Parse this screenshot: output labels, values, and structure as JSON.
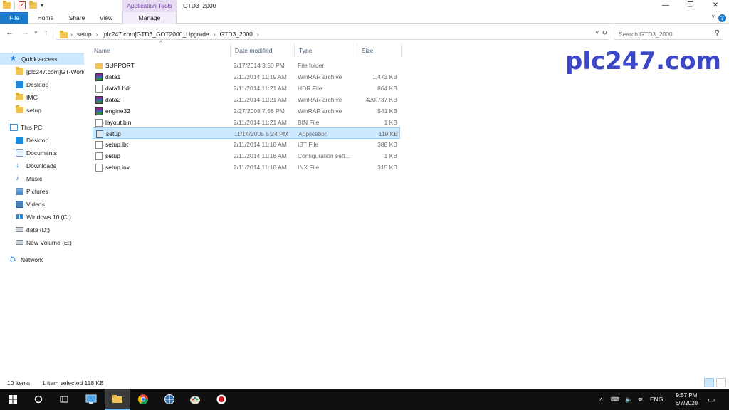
{
  "titlebar": {
    "contextual_group": "Application Tools",
    "window_title": "GTD3_2000",
    "minimize": "—",
    "maximize": "❐",
    "close": "✕"
  },
  "ribbon": {
    "tabs": [
      "File",
      "Home",
      "Share",
      "View",
      "Manage"
    ]
  },
  "address": {
    "crumbs": [
      "setup",
      "[plc247.com]GTD3_GOT2000_Upgrade",
      "GTD3_2000"
    ],
    "search_placeholder": "Search GTD3_2000"
  },
  "nav": {
    "items": [
      {
        "label": "Quick access",
        "icon": "star-icon"
      },
      {
        "label": "[plc247.com]GT-Works",
        "icon": "folder-icon"
      },
      {
        "label": "Desktop",
        "icon": "desktop-icon"
      },
      {
        "label": "IMG",
        "icon": "folder-icon"
      },
      {
        "label": "setup",
        "icon": "folder-icon"
      },
      {
        "label": "This PC",
        "icon": "pc-icon"
      },
      {
        "label": "Desktop",
        "icon": "desktop-icon"
      },
      {
        "label": "Documents",
        "icon": "documents-icon"
      },
      {
        "label": "Downloads",
        "icon": "download-icon"
      },
      {
        "label": "Music",
        "icon": "music-icon"
      },
      {
        "label": "Pictures",
        "icon": "pictures-icon"
      },
      {
        "label": "Videos",
        "icon": "videos-icon"
      },
      {
        "label": "Windows 10 (C:)",
        "icon": "windows-drive-icon"
      },
      {
        "label": "data (D:)",
        "icon": "drive-icon"
      },
      {
        "label": "New Volume (E:)",
        "icon": "drive-icon"
      },
      {
        "label": "Network",
        "icon": "network-icon"
      }
    ]
  },
  "columns": {
    "name": "Name",
    "date": "Date modified",
    "type": "Type",
    "size": "Size"
  },
  "files": [
    {
      "name": "SUPPORT",
      "date": "2/17/2014 3:50 PM",
      "type": "File folder",
      "size": "",
      "icon": "folder-icon"
    },
    {
      "name": "data1",
      "date": "2/11/2014 11:19 AM",
      "type": "WinRAR archive",
      "size": "1,473 KB",
      "icon": "winrar-icon"
    },
    {
      "name": "data1.hdr",
      "date": "2/11/2014 11:21 AM",
      "type": "HDR File",
      "size": "864 KB",
      "icon": "file-icon"
    },
    {
      "name": "data2",
      "date": "2/11/2014 11:21 AM",
      "type": "WinRAR archive",
      "size": "420,737 KB",
      "icon": "winrar-icon"
    },
    {
      "name": "engine32",
      "date": "2/27/2008 7:56 PM",
      "type": "WinRAR archive",
      "size": "541 KB",
      "icon": "winrar-icon"
    },
    {
      "name": "layout.bin",
      "date": "2/11/2014 11:21 AM",
      "type": "BIN File",
      "size": "1 KB",
      "icon": "file-icon"
    },
    {
      "name": "setup",
      "date": "11/14/2005 5:24 PM",
      "type": "Application",
      "size": "119 KB",
      "icon": "application-icon"
    },
    {
      "name": "setup.ibt",
      "date": "2/11/2014 11:18 AM",
      "type": "IBT File",
      "size": "388 KB",
      "icon": "file-icon"
    },
    {
      "name": "setup",
      "date": "2/11/2014 11:18 AM",
      "type": "Configuration sett...",
      "size": "1 KB",
      "icon": "config-icon"
    },
    {
      "name": "setup.inx",
      "date": "2/11/2014 11:18 AM",
      "type": "INX File",
      "size": "315 KB",
      "icon": "file-icon"
    }
  ],
  "watermark": "plc247.com",
  "status": {
    "items_count": "10 items",
    "selection": "1 item selected  118 KB"
  },
  "taskbar": {
    "lang": "ENG",
    "time": "9:57 PM",
    "date": "6/7/2020"
  }
}
